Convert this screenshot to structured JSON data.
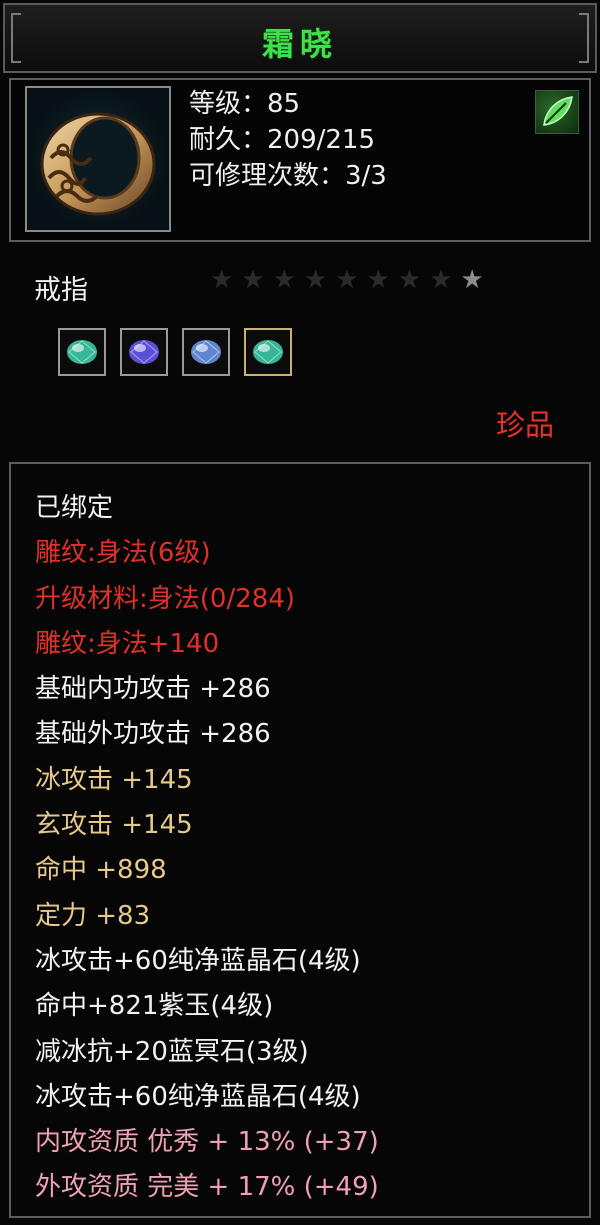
{
  "title": "霜晓",
  "stats": {
    "level": "等级：85",
    "durability": "耐久：209/215",
    "repairs": "可修理次数：3/3"
  },
  "item_type": "戒指",
  "stars": {
    "total": 9,
    "lit": 1
  },
  "gems": [
    {
      "name": "green-gem-icon",
      "color": "#3fd6b0",
      "frame": "#9a9a9a"
    },
    {
      "name": "purple-gem-icon",
      "color": "#6a5cff",
      "frame": "#9a9a9a"
    },
    {
      "name": "blue-gem-icon",
      "color": "#6e9cf2",
      "frame": "#9a9a9a"
    },
    {
      "name": "green-gem-icon",
      "color": "#3fd6b0",
      "frame": "#c8b070"
    }
  ],
  "quality": "珍品",
  "attributes": [
    {
      "text": "已绑定",
      "tone": "white"
    },
    {
      "text": "雕纹:身法(6级)",
      "tone": "red"
    },
    {
      "text": "升级材料:身法(0/284)",
      "tone": "red"
    },
    {
      "text": "雕纹:身法+140",
      "tone": "red"
    },
    {
      "text": "基础内功攻击 +286",
      "tone": "white"
    },
    {
      "text": "基础外功攻击 +286",
      "tone": "white"
    },
    {
      "text": "冰攻击 +145",
      "tone": "gold"
    },
    {
      "text": "玄攻击 +145",
      "tone": "gold"
    },
    {
      "text": "命中 +898",
      "tone": "gold"
    },
    {
      "text": "定力 +83",
      "tone": "gold"
    },
    {
      "text": "冰攻击+60纯净蓝晶石(4级)",
      "tone": "white"
    },
    {
      "text": "命中+821紫玉(4级)",
      "tone": "white"
    },
    {
      "text": "减冰抗+20蓝冥石(3级)",
      "tone": "white"
    },
    {
      "text": "冰攻击+60纯净蓝晶石(4级)",
      "tone": "white"
    },
    {
      "text": "内攻资质 优秀 + 13% (+37)",
      "tone": "pink"
    },
    {
      "text": "外攻资质 完美 + 17% (+49)",
      "tone": "pink"
    }
  ]
}
